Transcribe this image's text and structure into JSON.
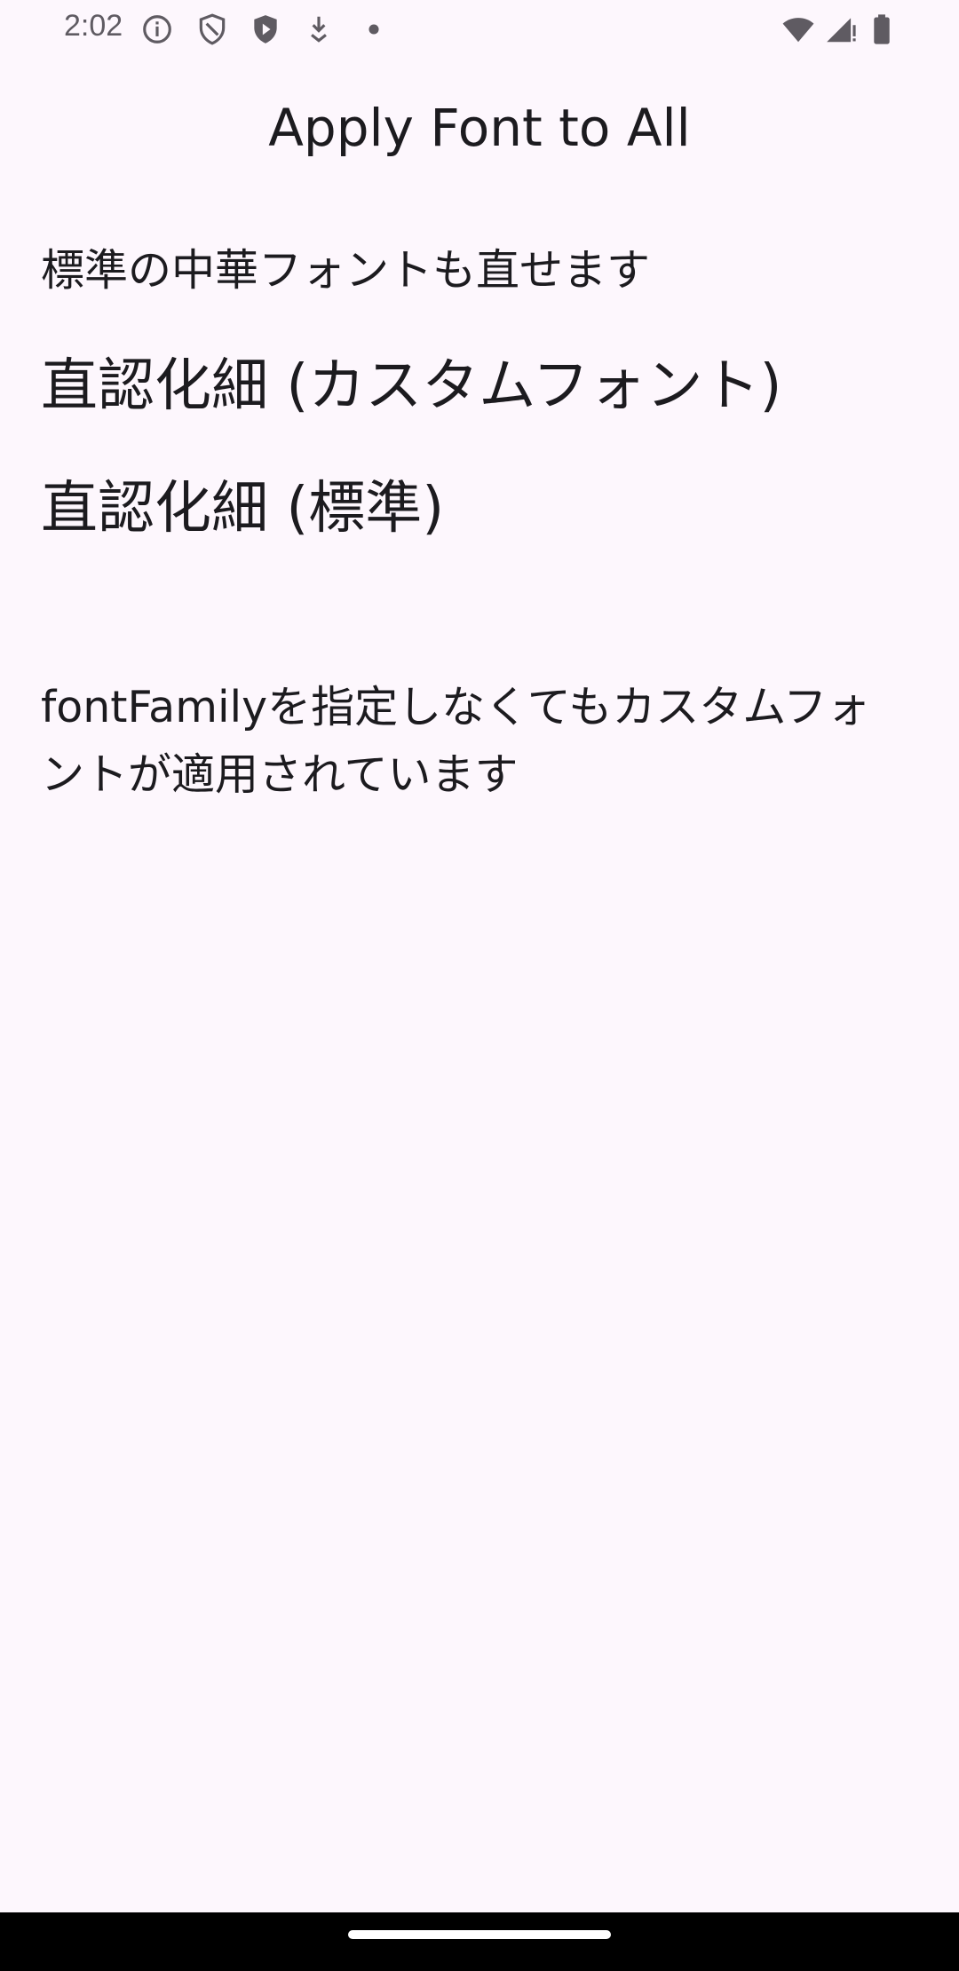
{
  "status_bar": {
    "time": "2:02",
    "icons": [
      "info-icon",
      "shield-outline-icon",
      "shield-play-icon",
      "download-icon",
      "dot-icon",
      "wifi-icon",
      "signal-icon",
      "battery-icon"
    ]
  },
  "app": {
    "title": "Apply Font to All"
  },
  "content": {
    "line1": "標準の中華フォントも直せます",
    "line2": "直認化細 (カスタムフォント)",
    "line3": "直認化細 (標準)",
    "line4": "fontFamilyを指定しなくてもカスタムフォントが適用されています"
  },
  "colors": {
    "background": "#fdf7fd",
    "text": "#1c1b1f",
    "status_text": "#5f5b62",
    "nav_bar": "#000000"
  }
}
